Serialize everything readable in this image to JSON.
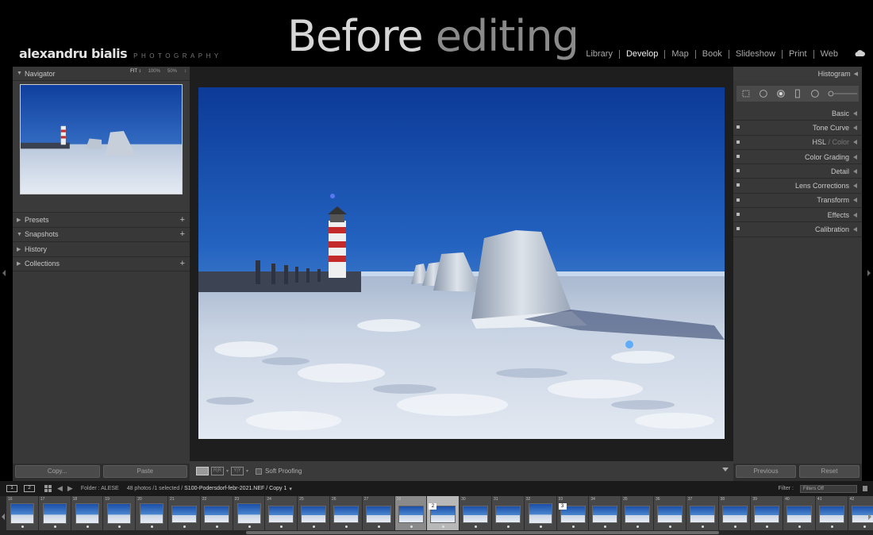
{
  "identity": {
    "name": "alexandru bialis",
    "subtitle": "PHOTOGRAPHY"
  },
  "overlay_title": {
    "word1": "Before",
    "word2": "editing"
  },
  "modules": [
    "Library",
    "Develop",
    "Map",
    "Book",
    "Slideshow",
    "Print",
    "Web"
  ],
  "active_module": "Develop",
  "left_panel": {
    "navigator": {
      "label": "Navigator",
      "zoom_fit": "FIT ↕",
      "zoom_100": "100%",
      "zoom_50": "50%",
      "zoom_more": "↕"
    },
    "sections": [
      {
        "label": "Presets",
        "has_plus": true
      },
      {
        "label": "Snapshots",
        "has_plus": true
      },
      {
        "label": "History",
        "has_plus": false
      },
      {
        "label": "Collections",
        "has_plus": true
      }
    ],
    "copy_label": "Copy...",
    "paste_label": "Paste"
  },
  "toolbar": {
    "before_after_1": "R|R",
    "before_after_2": "Y|Y",
    "soft_proofing": "Soft Proofing"
  },
  "right_panel": {
    "histogram": "Histogram",
    "basic": "Basic",
    "tone_curve": "Tone Curve",
    "hsl": "HSL",
    "color_sep": " / ",
    "color": "Color",
    "color_grading": "Color Grading",
    "detail": "Detail",
    "lens_corrections": "Lens Corrections",
    "transform": "Transform",
    "effects": "Effects",
    "calibration": "Calibration",
    "previous_label": "Previous",
    "reset_label": "Reset"
  },
  "filmstrip_bar": {
    "screen1": "1",
    "screen2": "2",
    "folder": "Folder : ALESE",
    "count": "48 photos /1 selected /",
    "filename": "S100-Podersdorf-febr-2021.NEF / Copy 1",
    "filter_label": "Filter :",
    "filter_value": "Filters Off"
  },
  "filmstrip": {
    "numbers": [
      "16",
      "17",
      "18",
      "19",
      "20",
      "21",
      "22",
      "23",
      "24",
      "25",
      "26",
      "27",
      "28",
      "29",
      "30",
      "31",
      "32",
      "33",
      "34",
      "35",
      "36",
      "37",
      "38",
      "39",
      "40",
      "41",
      "42"
    ],
    "selected_index": 12,
    "active_index": 13,
    "stack_badges": [
      {
        "index": 13,
        "label": "2"
      },
      {
        "index": 17,
        "label": "3"
      }
    ]
  },
  "colors": {
    "accent": "#f2f2f2",
    "panel": "#383838",
    "background": "#000000"
  }
}
